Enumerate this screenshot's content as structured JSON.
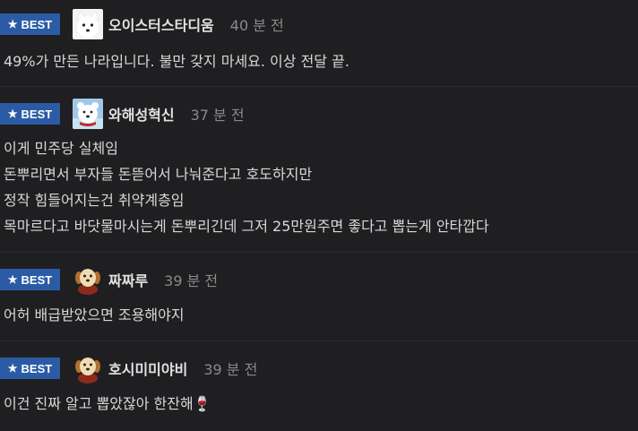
{
  "comments": [
    {
      "badge": "BEST",
      "avatar": "white-dog-avatar",
      "username": "오이스터스타디움",
      "time": "40 분 전",
      "lines": [
        "49%가 만든 나라입니다. 불만 갖지 마세요. 이상 전달 끝."
      ]
    },
    {
      "badge": "BEST",
      "avatar": "polar-bear-avatar",
      "username": "와해성혁신",
      "time": "37 분 전",
      "lines": [
        "이게 민주당 실체임",
        "돈뿌리면서 부자들 돈뜯어서 나눠준다고 호도하지만",
        "정작 힘들어지는건 취약계층임",
        "목마르다고 바닷물마시는게 돈뿌리긴데 그저 25만원주면 좋다고 뽑는게 안타깝다"
      ]
    },
    {
      "badge": "BEST",
      "avatar": "puppy-avatar",
      "username": "짜짜루",
      "time": "39 분 전",
      "lines": [
        "어허 배급받았으면 조용해야지"
      ]
    },
    {
      "badge": "BEST",
      "avatar": "puppy-avatar",
      "username": "호시미미야비",
      "time": "39 분 전",
      "lines": [
        "이건 진짜 알고 뽑았잖아 한잔해🍷"
      ]
    }
  ],
  "colors": {
    "background": "#1f1f21",
    "badge": "#2b5ba5",
    "divider": "#2d2d30"
  }
}
